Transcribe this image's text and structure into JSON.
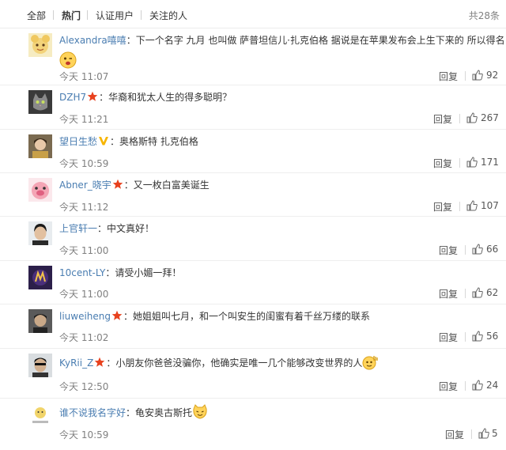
{
  "tabs": [
    {
      "label": "全部",
      "active": false
    },
    {
      "label": "热门",
      "active": true
    },
    {
      "label": "认证用户",
      "active": false
    },
    {
      "label": "关注的人",
      "active": false
    }
  ],
  "total_count": "共28条",
  "comments": [
    {
      "user": "Alexandra嘻嘻",
      "badge": "",
      "text": "：下一个名字 九月 也叫做 萨普坦信儿·扎克伯格 据说是在苹果发布会上生下来的 所以得名",
      "emoji": "wink-emoji",
      "time": "今天 11:07",
      "reply": "回复",
      "likes": "92"
    },
    {
      "user": "DZH7",
      "badge": "star-badge",
      "text": "：华裔和犹太人生的得多聪明？",
      "emoji": "",
      "time": "今天 11:21",
      "reply": "回复",
      "likes": "267"
    },
    {
      "user": "望日生愁",
      "badge": "v-badge",
      "text": "：奥格斯特 扎克伯格",
      "emoji": "",
      "time": "今天 10:59",
      "reply": "回复",
      "likes": "171"
    },
    {
      "user": "Abner_晓宇",
      "badge": "star-badge",
      "text": "：又一枚白富美诞生",
      "emoji": "",
      "time": "今天 11:12",
      "reply": "回复",
      "likes": "107"
    },
    {
      "user": "上官轩一",
      "badge": "",
      "text": "：中文真好！",
      "emoji": "",
      "time": "今天 11:00",
      "reply": "回复",
      "likes": "66"
    },
    {
      "user": "10cent-LY",
      "badge": "",
      "text": "：请受小媚一拜！",
      "emoji": "",
      "time": "今天 11:00",
      "reply": "回复",
      "likes": "62"
    },
    {
      "user": "liuweiheng",
      "badge": "star-badge",
      "text": "：她姐姐叫七月，和一个叫安生的闺蜜有着千丝万缕的联系",
      "emoji": "",
      "time": "今天 11:02",
      "reply": "回复",
      "likes": "56"
    },
    {
      "user": "KyRii_Z",
      "badge": "star-badge",
      "text": "：小朋友你爸爸没骗你，他确实是唯一几个能够改变世界的人",
      "emoji": "bye-emoji",
      "time": "今天 12:50",
      "reply": "回复",
      "likes": "24"
    },
    {
      "user": "谁不说我名字好",
      "badge": "",
      "text": "：龟安奥古斯托",
      "emoji": "cat-emoji",
      "time": "今天 10:59",
      "reply": "回复",
      "likes": "5"
    }
  ],
  "colors": {
    "link": "#4a7db1",
    "star": "#e8411e",
    "v_badge": "#f7b500",
    "meta": "#808080"
  }
}
